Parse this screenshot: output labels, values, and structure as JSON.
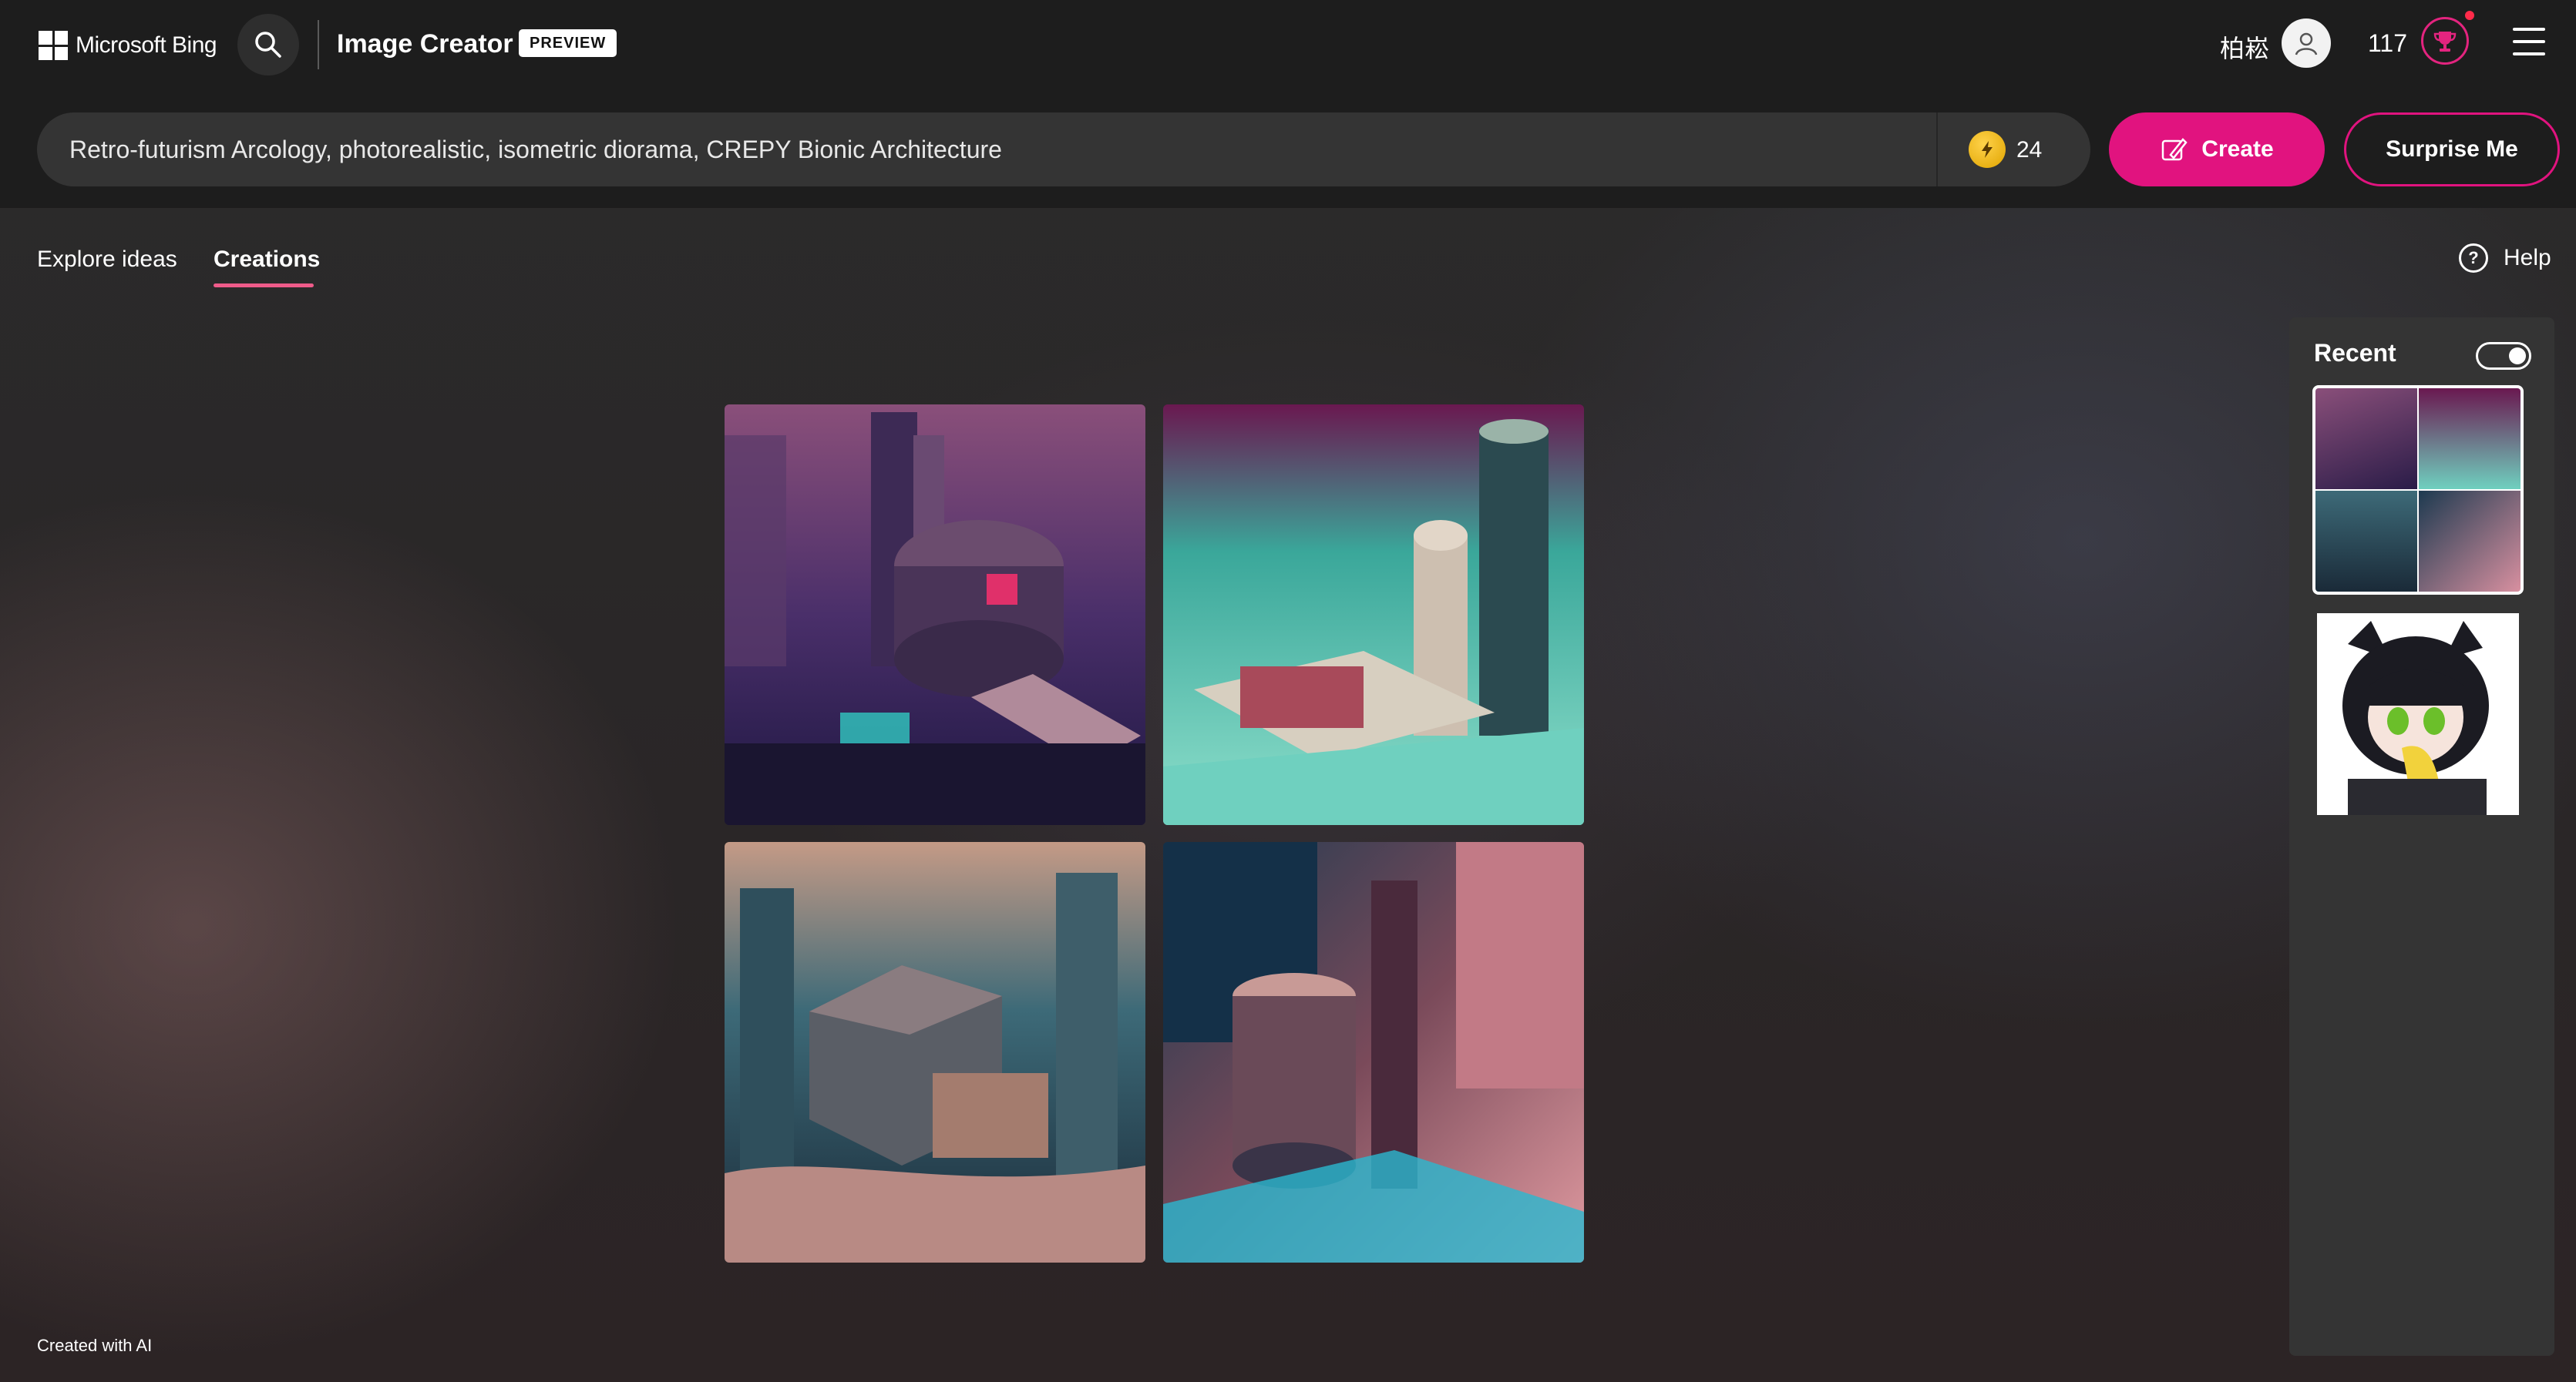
{
  "header": {
    "brand": "Microsoft Bing",
    "app_title": "Image Creator",
    "badge": "PREVIEW",
    "user_name": "柏崧",
    "points": "117"
  },
  "prompt": {
    "value": "Retro-futurism Arcology, photorealistic, isometric diorama, CREPY Bionic Architecture",
    "boosts": "24"
  },
  "buttons": {
    "create": "Create",
    "surprise": "Surprise Me"
  },
  "tabs": [
    {
      "label": "Explore ideas",
      "active": false
    },
    {
      "label": "Creations",
      "active": true
    }
  ],
  "help_label": "Help",
  "recent": {
    "title": "Recent",
    "toggle_on": true
  },
  "footer_note": "Created with AI",
  "colors": {
    "accent": "#e1137f",
    "header_bg": "#1d1d1d",
    "tab_underline": "#ef5b8a"
  },
  "icons": [
    "windows-logo-icon",
    "search-icon",
    "user-icon",
    "trophy-icon",
    "hamburger-menu-icon",
    "lightning-icon",
    "create-brush-icon",
    "help-icon"
  ]
}
